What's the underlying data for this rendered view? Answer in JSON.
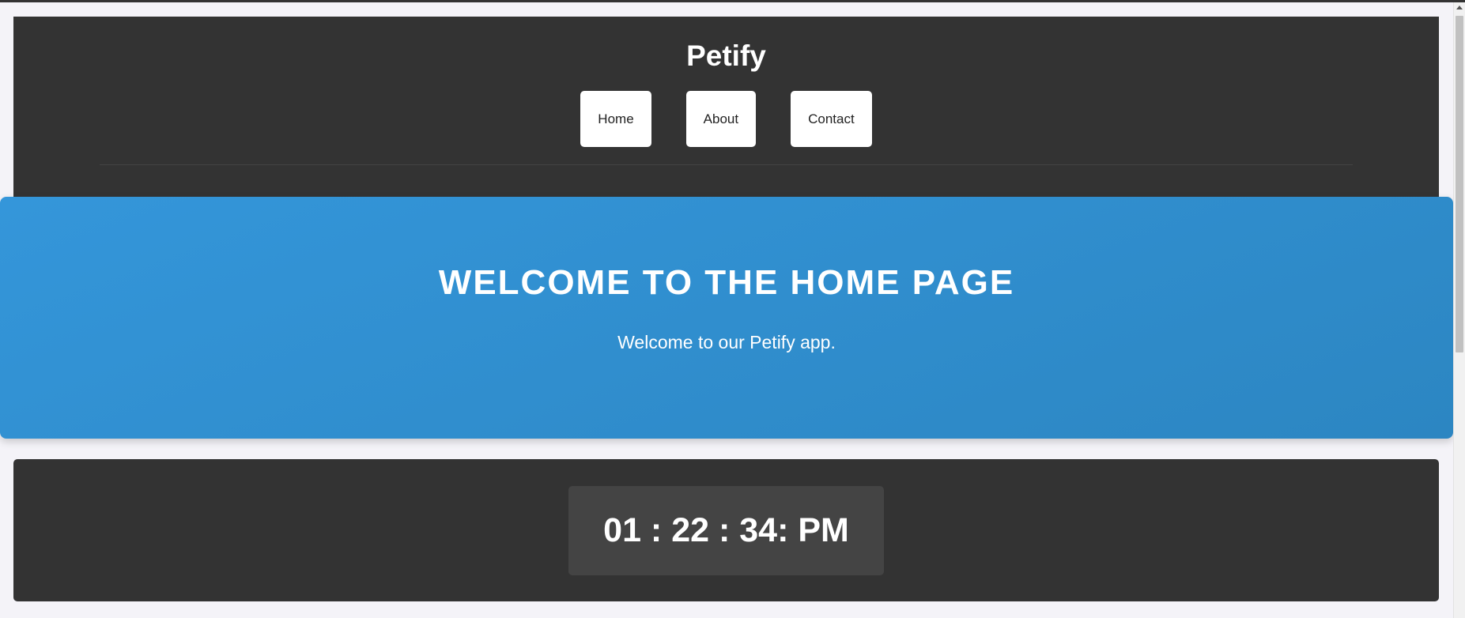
{
  "header": {
    "brand": "Petify",
    "nav": [
      {
        "label": "Home"
      },
      {
        "label": "About"
      },
      {
        "label": "Contact"
      }
    ]
  },
  "hero": {
    "title": "WELCOME TO THE HOME PAGE",
    "subtitle": "Welcome to our Petify app."
  },
  "clock": {
    "time": "01 : 22 : 34: PM"
  },
  "colors": {
    "header_bg": "#333333",
    "hero_gradient_start": "#3496da",
    "hero_gradient_end": "#2c86c2",
    "page_bg": "#f4f3f8"
  }
}
